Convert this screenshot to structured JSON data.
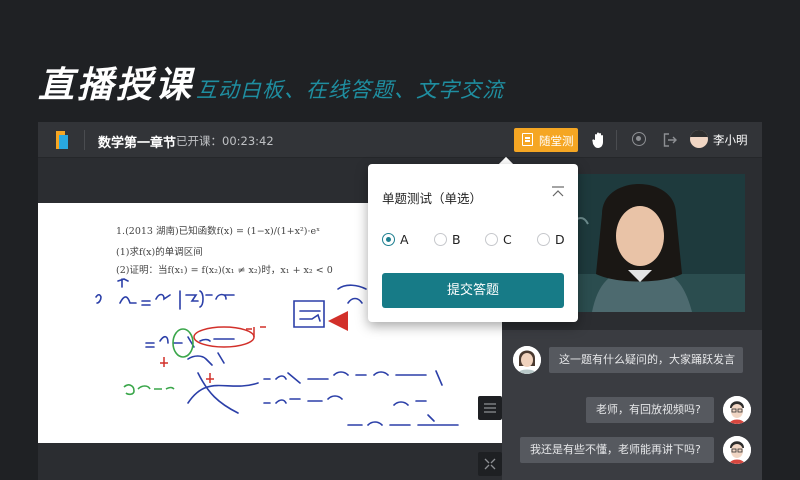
{
  "hero": {
    "title": "直播授课",
    "subtitle": "互动白板、在线答题、文字交流"
  },
  "topbar": {
    "course_title": "数学第一章节",
    "course_time": "已开课：00:23:42",
    "quiz_label": "随堂测",
    "user_name": "李小明"
  },
  "dialog": {
    "title": "单题测试（单选）",
    "options": [
      "A",
      "B",
      "C",
      "D"
    ],
    "selected": "A",
    "submit_label": "提交答题"
  },
  "whiteboard": {
    "problem_line1": "1.(2013 湖南)已知函数f(x) = (1−x)/(1+x²)·eˣ",
    "problem_line2": "(1)求f(x)的单调区间",
    "problem_line3": "(2)证明：当f(x₁) = f(x₂)(x₁ ≠ x₂)时，x₁ + x₂ < 0"
  },
  "chat": {
    "messages": [
      {
        "from": "teacher",
        "text": "这一题有什么疑问的，大家踊跃发言"
      },
      {
        "from": "student",
        "text": "老师，有回放视频吗?"
      },
      {
        "from": "student",
        "text": "我还是有些不懂，老师能再讲下吗?"
      }
    ]
  },
  "colors": {
    "accent": "#177b87",
    "quiz": "#f5a623",
    "subtitle": "#1f8ea0"
  }
}
